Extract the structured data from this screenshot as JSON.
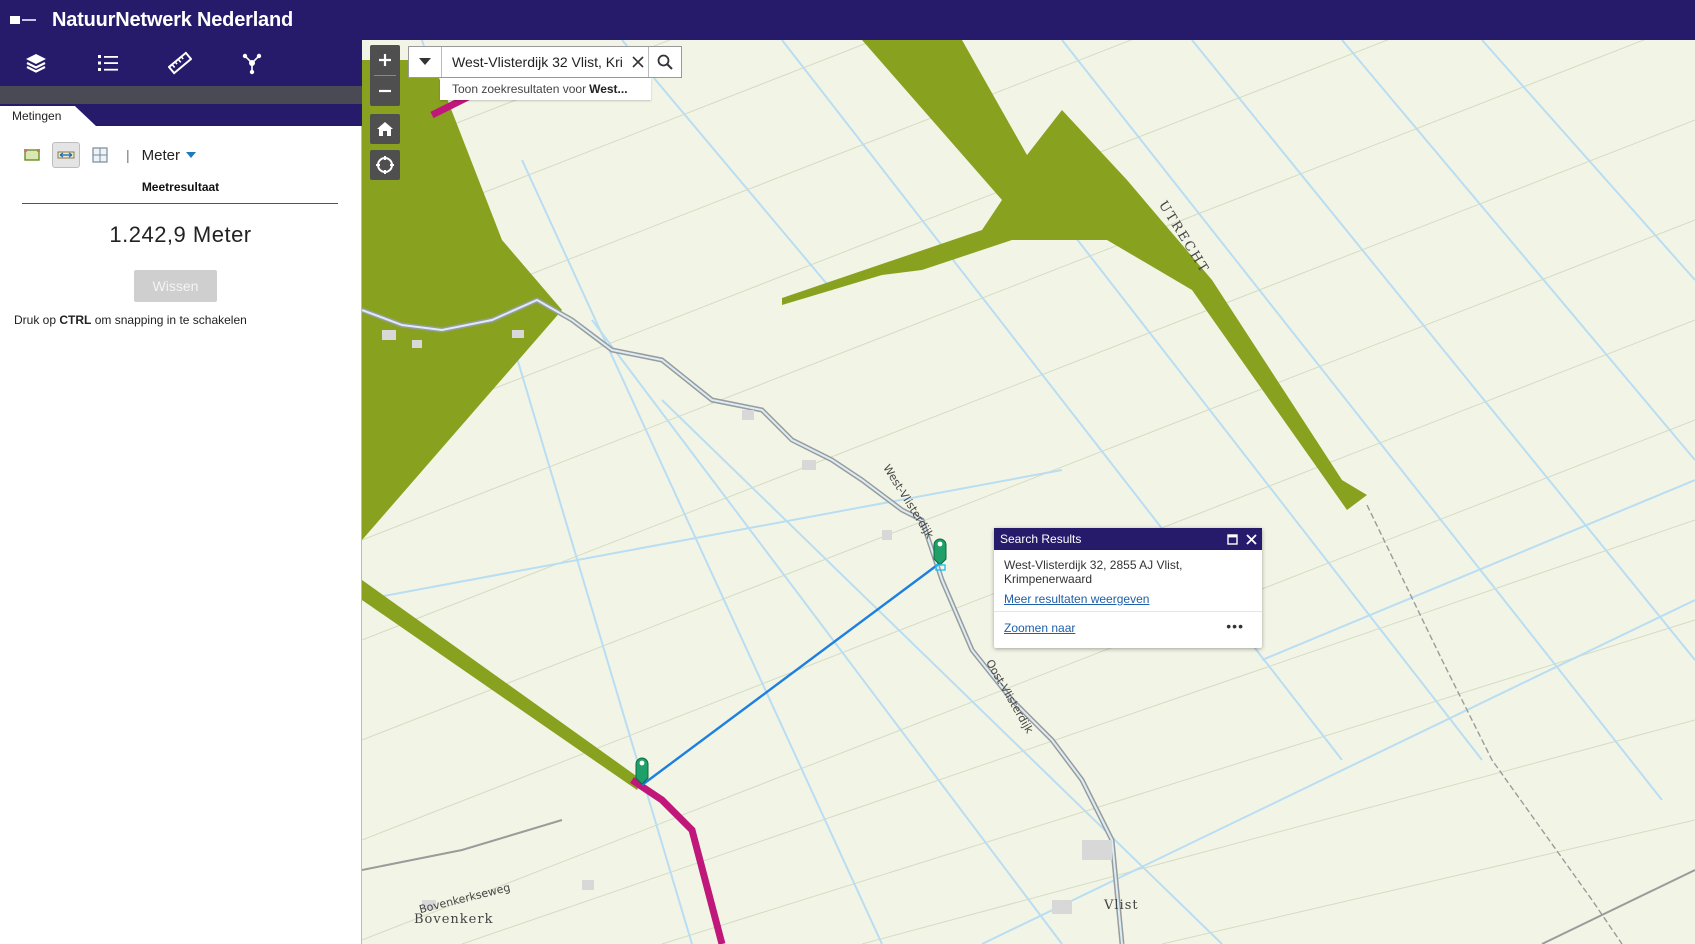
{
  "header": {
    "title": "NatuurNetwerk Nederland"
  },
  "toolbar": {
    "items": [
      "layers-icon",
      "legend-list-icon",
      "measure-ruler-icon",
      "share-icon"
    ]
  },
  "panel": {
    "tab_label": "Metingen",
    "unit": "Meter",
    "result_label": "Meetresultaat",
    "result_value": "1.242,9 Meter",
    "clear_button": "Wissen",
    "hint_prefix": "Druk op",
    "hint_key": "CTRL",
    "hint_suffix": "om snapping in te schakelen"
  },
  "map": {
    "search_value": "West-Vlisterdijk 32 Vlist, Kri",
    "suggestion_prefix": "Toon zoekresultaten voor",
    "suggestion_term": "West...",
    "popup": {
      "title": "Search Results",
      "address": "West-Vlisterdijk 32, 2855 AJ Vlist, Krimpenerwaard",
      "more_results": "Meer resultaten weergeven",
      "zoom_to": "Zoomen naar",
      "more_icon": "•••"
    },
    "labels": {
      "utrecht": "UTRECHT",
      "west_vlisterdijk": "West-Vlisterdijk",
      "oost_vlisterdijk": "Oost-Vlisterdijk",
      "bovenkerkseweg": "Bovenkerkseweg",
      "bovenkerk": "Bovenkerk",
      "vlist": "Vlist"
    },
    "colors": {
      "nature": "#88a220",
      "corridor": "#c0187a",
      "measure_line": "#1d7fe0",
      "header": "#261a6b"
    }
  }
}
